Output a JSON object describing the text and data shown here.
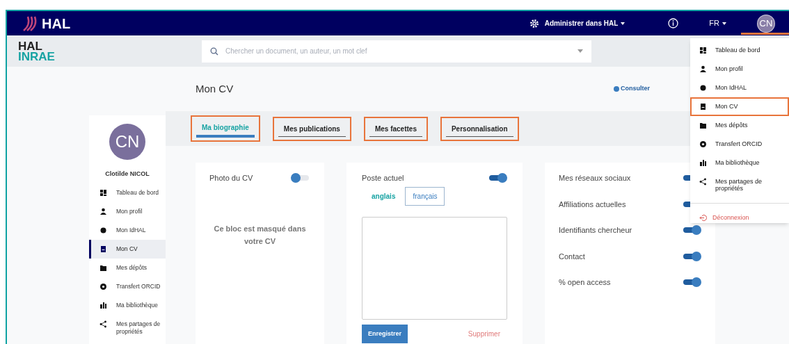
{
  "topbar": {
    "brand": "HAL",
    "admin_menu": "Administrer dans HAL",
    "language": "FR",
    "avatar": "CN"
  },
  "header": {
    "logo_top": "HAL",
    "logo_bottom": "INRAE",
    "search": {
      "placeholder": "Chercher un document, un auteur, un mot clef"
    }
  },
  "profile": {
    "avatar": "CN",
    "name": "Clotilde NICOL"
  },
  "sidebar": {
    "items": [
      {
        "label": "Tableau de bord",
        "selected": false
      },
      {
        "label": "Mon profil",
        "selected": false
      },
      {
        "label": "Mon IdHAL",
        "selected": false
      },
      {
        "label": "Mon CV",
        "selected": true
      },
      {
        "label": "Mes dépôts",
        "selected": false
      },
      {
        "label": "Transfert ORCID",
        "selected": false
      },
      {
        "label": "Ma bibliothèque",
        "selected": false
      },
      {
        "label": "Mes partages de propriétés",
        "selected": false
      }
    ]
  },
  "page": {
    "title": "Mon CV",
    "actions": [
      "Consulter"
    ]
  },
  "tabs": [
    {
      "label": "Ma biographie",
      "selected": true,
      "highlighted": true
    },
    {
      "label": "Mes publications",
      "selected": false,
      "highlighted": true
    },
    {
      "label": "Mes facettes",
      "selected": false,
      "highlighted": true
    },
    {
      "label": "Personnalisation",
      "selected": false,
      "highlighted": true
    }
  ],
  "photo_card": {
    "label": "Photo du CV",
    "on": false,
    "hidden_message": "Ce bloc est masqué dans votre CV"
  },
  "position_card": {
    "label": "Poste actuel",
    "on": true,
    "languages": [
      {
        "label": "anglais",
        "selected": true
      },
      {
        "label": "français",
        "selected": false
      }
    ],
    "save": "Enregistrer",
    "delete": "Supprimer"
  },
  "sections": [
    {
      "label": "Mes réseaux sociaux",
      "on": true
    },
    {
      "label": "Affiliations actuelles",
      "on": true
    },
    {
      "label": "Identifiants chercheur",
      "on": true
    },
    {
      "label": "Contact",
      "on": true
    },
    {
      "label": "% open access",
      "on": true
    }
  ],
  "user_menu": {
    "items": [
      {
        "label": "Tableau de bord",
        "highlighted": false
      },
      {
        "label": "Mon profil",
        "highlighted": false
      },
      {
        "label": "Mon IdHAL",
        "highlighted": false
      },
      {
        "label": "Mon CV",
        "highlighted": true
      },
      {
        "label": "Mes dépôts",
        "highlighted": false
      },
      {
        "label": "Transfert ORCID",
        "highlighted": false
      },
      {
        "label": "Ma bibliothèque",
        "highlighted": false
      },
      {
        "label": "Mes partages de propriétés",
        "highlighted": false
      }
    ],
    "logout": "Déconnexion"
  }
}
